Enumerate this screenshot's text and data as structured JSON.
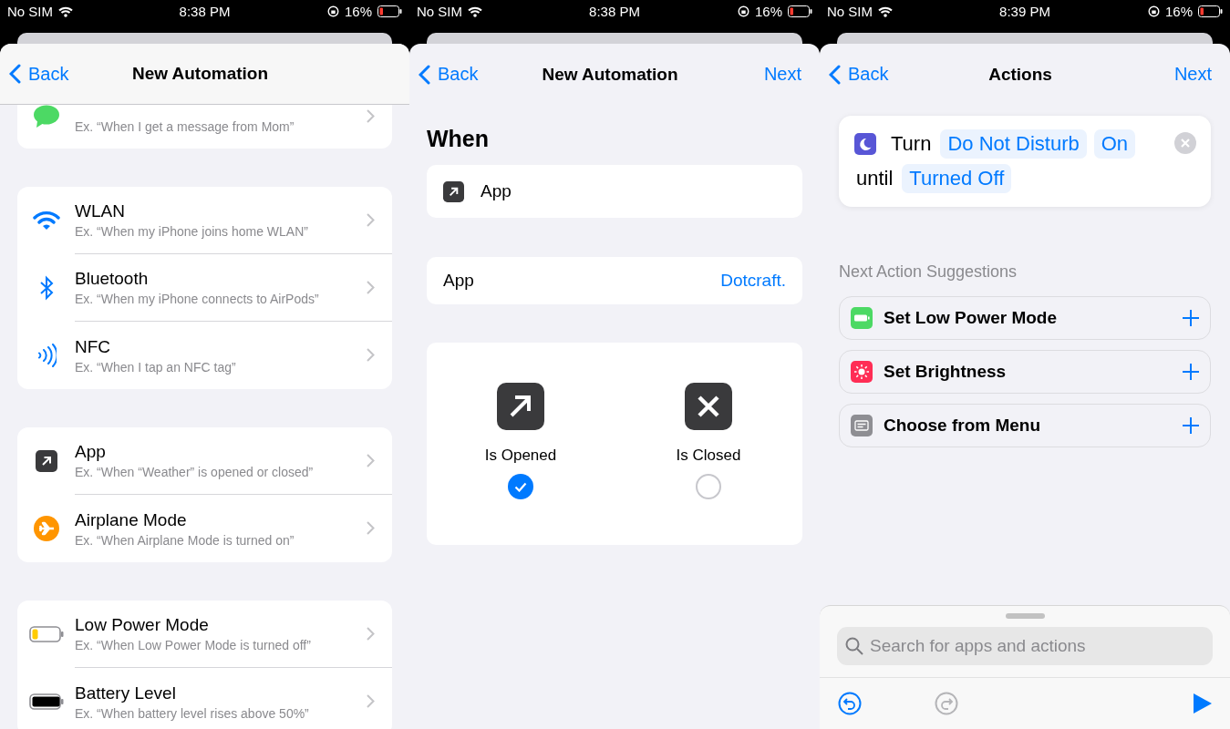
{
  "screens": [
    {
      "status_bar": {
        "carrier": "No SIM",
        "time": "8:38 PM",
        "battery": "16%"
      },
      "nav": {
        "back": "Back",
        "title": "New Automation"
      },
      "sections": [
        {
          "items": [
            {
              "kind": "message",
              "subtitle": "Ex. “When I get a message from Mom”"
            }
          ]
        },
        {
          "items": [
            {
              "kind": "wifi",
              "title": "WLAN",
              "subtitle": "Ex. “When my iPhone joins home WLAN”"
            },
            {
              "kind": "bluetooth",
              "title": "Bluetooth",
              "subtitle": "Ex. “When my iPhone connects to AirPods”"
            },
            {
              "kind": "nfc",
              "title": "NFC",
              "subtitle": "Ex. “When I tap an NFC tag”"
            }
          ]
        },
        {
          "items": [
            {
              "kind": "app",
              "title": "App",
              "subtitle": "Ex. “When “Weather” is opened or closed”"
            },
            {
              "kind": "airplane",
              "title": "Airplane Mode",
              "subtitle": "Ex. “When Airplane Mode is turned on”"
            }
          ]
        },
        {
          "items": [
            {
              "kind": "lowpower",
              "title": "Low Power Mode",
              "subtitle": "Ex. “When Low Power Mode is turned off”"
            },
            {
              "kind": "battery",
              "title": "Battery Level",
              "subtitle": "Ex. “When battery level rises above 50%”"
            }
          ]
        }
      ]
    },
    {
      "status_bar": {
        "carrier": "No SIM",
        "time": "8:38 PM",
        "battery": "16%"
      },
      "nav": {
        "back": "Back",
        "title": "New Automation",
        "next": "Next"
      },
      "heading": "When",
      "trigger": "App",
      "app_row": {
        "label": "App",
        "value": "Dotcraft."
      },
      "options": [
        {
          "kind": "opened",
          "label": "Is Opened",
          "selected": true
        },
        {
          "kind": "closed",
          "label": "Is Closed",
          "selected": false
        }
      ]
    },
    {
      "status_bar": {
        "carrier": "No SIM",
        "time": "8:39 PM",
        "battery": "16%"
      },
      "nav": {
        "back": "Back",
        "title": "Actions",
        "next": "Next"
      },
      "action": [
        {
          "kind": "text",
          "text": "Turn"
        },
        {
          "kind": "token",
          "text": "Do Not Disturb"
        },
        {
          "kind": "token",
          "text": "On"
        },
        {
          "kind": "text",
          "text": "until"
        },
        {
          "kind": "token",
          "text": "Turned Off"
        }
      ],
      "suggestions_title": "Next Action Suggestions",
      "suggestions": [
        {
          "kind": "lowpower",
          "label": "Set Low Power Mode"
        },
        {
          "kind": "brightness",
          "label": "Set Brightness"
        },
        {
          "kind": "menu",
          "label": "Choose from Menu"
        }
      ],
      "search": {
        "placeholder": "Search for apps and actions"
      }
    }
  ]
}
